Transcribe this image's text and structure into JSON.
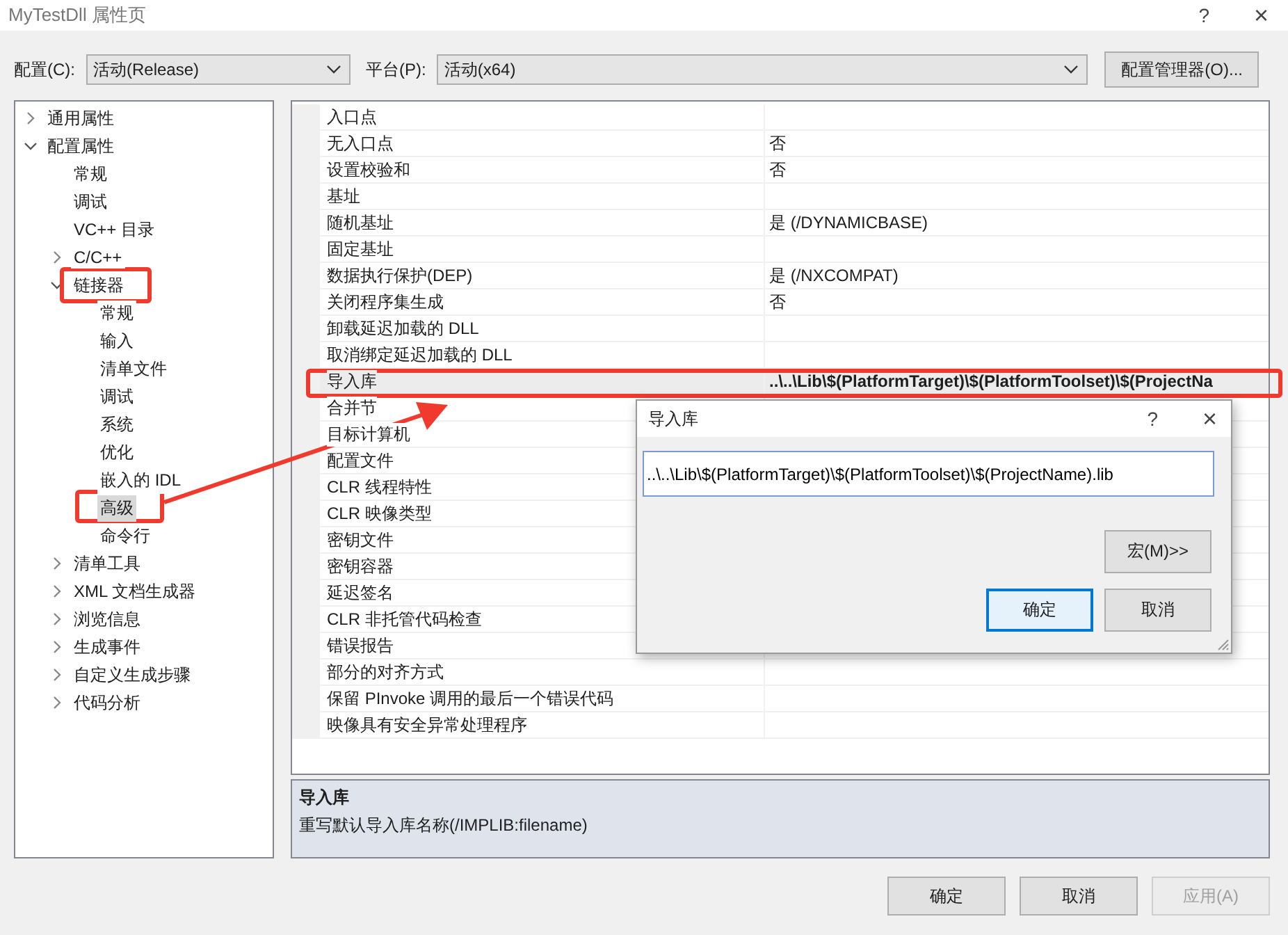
{
  "window": {
    "title": "MyTestDll 属性页",
    "help": "?",
    "close": "×"
  },
  "config": {
    "config_label": "配置(C):",
    "config_value": "活动(Release)",
    "platform_label": "平台(P):",
    "platform_value": "活动(x64)",
    "manager_button": "配置管理器(O)..."
  },
  "tree": [
    {
      "label": "通用属性",
      "expanded": false,
      "selected": false
    },
    {
      "label": "配置属性",
      "expanded": true,
      "selected": false,
      "children": [
        {
          "label": "常规",
          "selected": false
        },
        {
          "label": "调试",
          "selected": false
        },
        {
          "label": "VC++ 目录",
          "selected": false
        },
        {
          "label": "C/C++",
          "expanded": false,
          "selected": false
        },
        {
          "label": "链接器",
          "expanded": true,
          "selected": false,
          "children": [
            {
              "label": "常规",
              "selected": false
            },
            {
              "label": "输入",
              "selected": false
            },
            {
              "label": "清单文件",
              "selected": false
            },
            {
              "label": "调试",
              "selected": false
            },
            {
              "label": "系统",
              "selected": false
            },
            {
              "label": "优化",
              "selected": false
            },
            {
              "label": "嵌入的 IDL",
              "selected": false
            },
            {
              "label": "高级",
              "selected": true
            },
            {
              "label": "命令行",
              "selected": false
            }
          ]
        },
        {
          "label": "清单工具",
          "expanded": false,
          "selected": false
        },
        {
          "label": "XML 文档生成器",
          "expanded": false,
          "selected": false
        },
        {
          "label": "浏览信息",
          "expanded": false,
          "selected": false
        },
        {
          "label": "生成事件",
          "expanded": false,
          "selected": false
        },
        {
          "label": "自定义生成步骤",
          "expanded": false,
          "selected": false
        },
        {
          "label": "代码分析",
          "expanded": false,
          "selected": false
        }
      ]
    }
  ],
  "properties": [
    {
      "name": "入口点",
      "selected": false
    },
    {
      "name": "无入口点",
      "value": "否",
      "selected": false,
      "modified": false
    },
    {
      "name": "设置校验和",
      "value": "否",
      "selected": false,
      "modified": false
    },
    {
      "name": "基址",
      "selected": false
    },
    {
      "name": "随机基址",
      "value": "是 (/DYNAMICBASE)",
      "selected": false,
      "modified": false
    },
    {
      "name": "固定基址",
      "selected": false
    },
    {
      "name": "数据执行保护(DEP)",
      "value": "是 (/NXCOMPAT)",
      "selected": false,
      "modified": false
    },
    {
      "name": "关闭程序集生成",
      "value": "否",
      "selected": false,
      "modified": false
    },
    {
      "name": "卸载延迟加载的 DLL",
      "selected": false
    },
    {
      "name": "取消绑定延迟加载的 DLL",
      "selected": false
    },
    {
      "name": "导入库",
      "value": "..\\..\\Lib\\$(PlatformTarget)\\$(PlatformToolset)\\$(ProjectNa",
      "selected": true,
      "modified": true
    },
    {
      "name": "合并节",
      "selected": false
    },
    {
      "name": "目标计算机",
      "selected": false
    },
    {
      "name": "配置文件",
      "selected": false
    },
    {
      "name": "CLR 线程特性",
      "selected": false
    },
    {
      "name": "CLR 映像类型",
      "selected": false
    },
    {
      "name": "密钥文件",
      "selected": false
    },
    {
      "name": "密钥容器",
      "selected": false
    },
    {
      "name": "延迟签名",
      "selected": false
    },
    {
      "name": "CLR 非托管代码检查",
      "selected": false
    },
    {
      "name": "错误报告",
      "selected": false
    },
    {
      "name": "部分的对齐方式",
      "selected": false
    },
    {
      "name": "保留 PInvoke 调用的最后一个错误代码",
      "selected": false
    },
    {
      "name": "映像具有安全异常处理程序",
      "selected": false
    }
  ],
  "description": {
    "title": "导入库",
    "text": "重写默认导入库名称(/IMPLIB:filename)"
  },
  "buttons": [
    {
      "label": "确定",
      "disabled": false
    },
    {
      "label": "取消",
      "disabled": false
    },
    {
      "label": "应用(A)",
      "disabled": true
    }
  ],
  "dialog": {
    "title": "导入库",
    "help": "?",
    "close": "×",
    "value": "..\\..\\Lib\\$(PlatformTarget)\\$(PlatformToolset)\\$(ProjectName).lib",
    "macro_button": "宏(M)>>",
    "buttons": [
      {
        "label": "确定",
        "focused": true
      },
      {
        "label": "取消",
        "focused": false
      }
    ]
  }
}
